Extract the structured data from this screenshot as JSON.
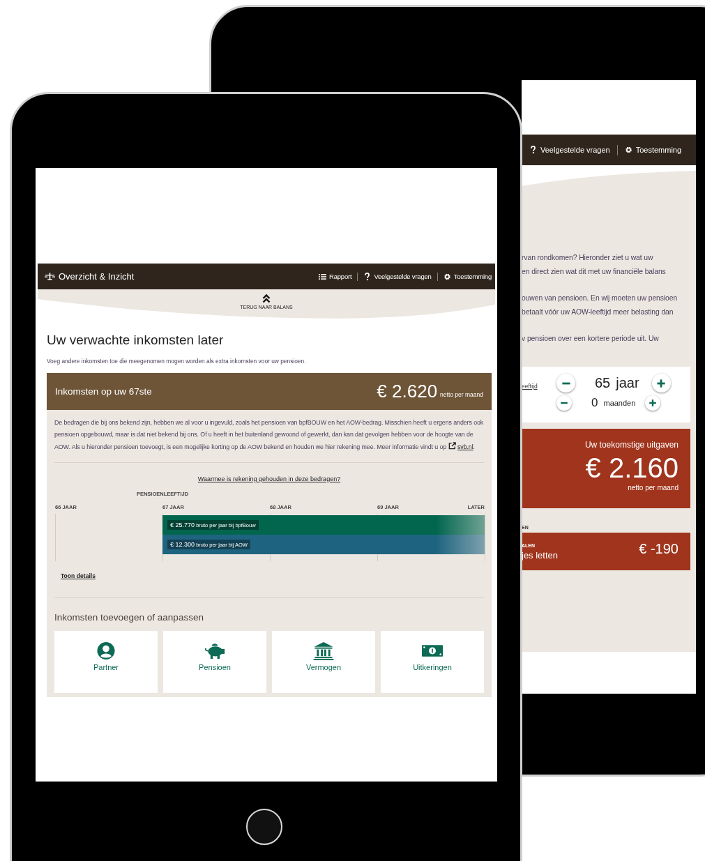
{
  "back": {
    "nav_links": [
      {
        "kind": "question",
        "label": "Veelgestelde vragen"
      },
      {
        "kind": "gear",
        "label": "Toestemming"
      }
    ],
    "paragraphs": [
      [
        "rvan rondkomen? Hieronder ziet u wat uw",
        "en direct zien wat dit met uw financiële balans"
      ],
      [
        "ouwen van pensioen. En wij moeten uw pensioen",
        "betaalt vóór uw AOW-leeftijd meer belasting dan"
      ],
      [
        "v pensioen over een kortere periode uit. Uw"
      ]
    ],
    "age_link": "eeftijd",
    "steppers": [
      {
        "value": "65",
        "unit": "jaar"
      },
      {
        "value": "0",
        "unit": "maanden"
      }
    ],
    "expenses": {
      "title": "Uw toekomstige uitgaven",
      "amount": "€ 2.160",
      "unit": "netto per maand"
    },
    "section_label": "EN",
    "result": {
      "label": "ALEN",
      "text": "jes letten",
      "amount": "€ -190"
    }
  },
  "front": {
    "nav": {
      "brand": "Overzicht & Inzicht",
      "links": [
        {
          "kind": "list",
          "label": "Rapport"
        },
        {
          "kind": "question",
          "label": "Veelgestelde vragen"
        },
        {
          "kind": "gear",
          "label": "Toestemming"
        }
      ]
    },
    "back_link": "TERUG NAAR BALANS",
    "title": "Uw verwachte inkomsten later",
    "intro": "Voeg andere inkomsten toe die meegenomen mogen worden als extra inkomsten voor uw pensioen.",
    "income_card": {
      "title": "Inkomsten op uw 67ste",
      "amount": "€ 2.620",
      "unit": "netto per maand",
      "text": "De bedragen die bij ons bekend zijn, hebben we al voor u ingevuld, zoals het pensioen van bpfBOUW en het AOW-bedrag. Misschien heeft u ergens anders ook pensioen opgebouwd, maar is dat niet bekend bij ons. Of u heeft in het buitenland gewoond of gewerkt, dan kan dat gevolgen hebben voor de hoogte van de AOW. Als u hieronder pensioen toevoegt, is een mogelijke korting op de AOW bekend en houden we hier rekening mee. Meer informatie vindt u op",
      "link": "svb.nl",
      "after": "."
    },
    "explain_link": "Waarmee is rekening gehouden in deze bedragen?",
    "timeline": {
      "axis_title": "PENSIOENLEEFTIJD",
      "ticks": [
        "66 JAAR",
        "67 JAAR",
        "68 JAAR",
        "69 JAAR",
        "LATER"
      ],
      "bars": [
        {
          "amount": "€ 25.770",
          "label": "bruto per jaar bij bpfBouw",
          "color": "#02664f"
        },
        {
          "amount": "€ 12.300",
          "label": "bruto per jaar bij AOW",
          "color": "#1e6480"
        }
      ]
    },
    "details_link": "Toon details",
    "add_title": "Inkomsten toevoegen of aanpassen",
    "options": [
      {
        "kind": "partner",
        "label": "Partner"
      },
      {
        "kind": "pension",
        "label": "Pensioen"
      },
      {
        "kind": "assets",
        "label": "Vermogen"
      },
      {
        "kind": "benefits",
        "label": "Uitkeringen"
      }
    ]
  }
}
